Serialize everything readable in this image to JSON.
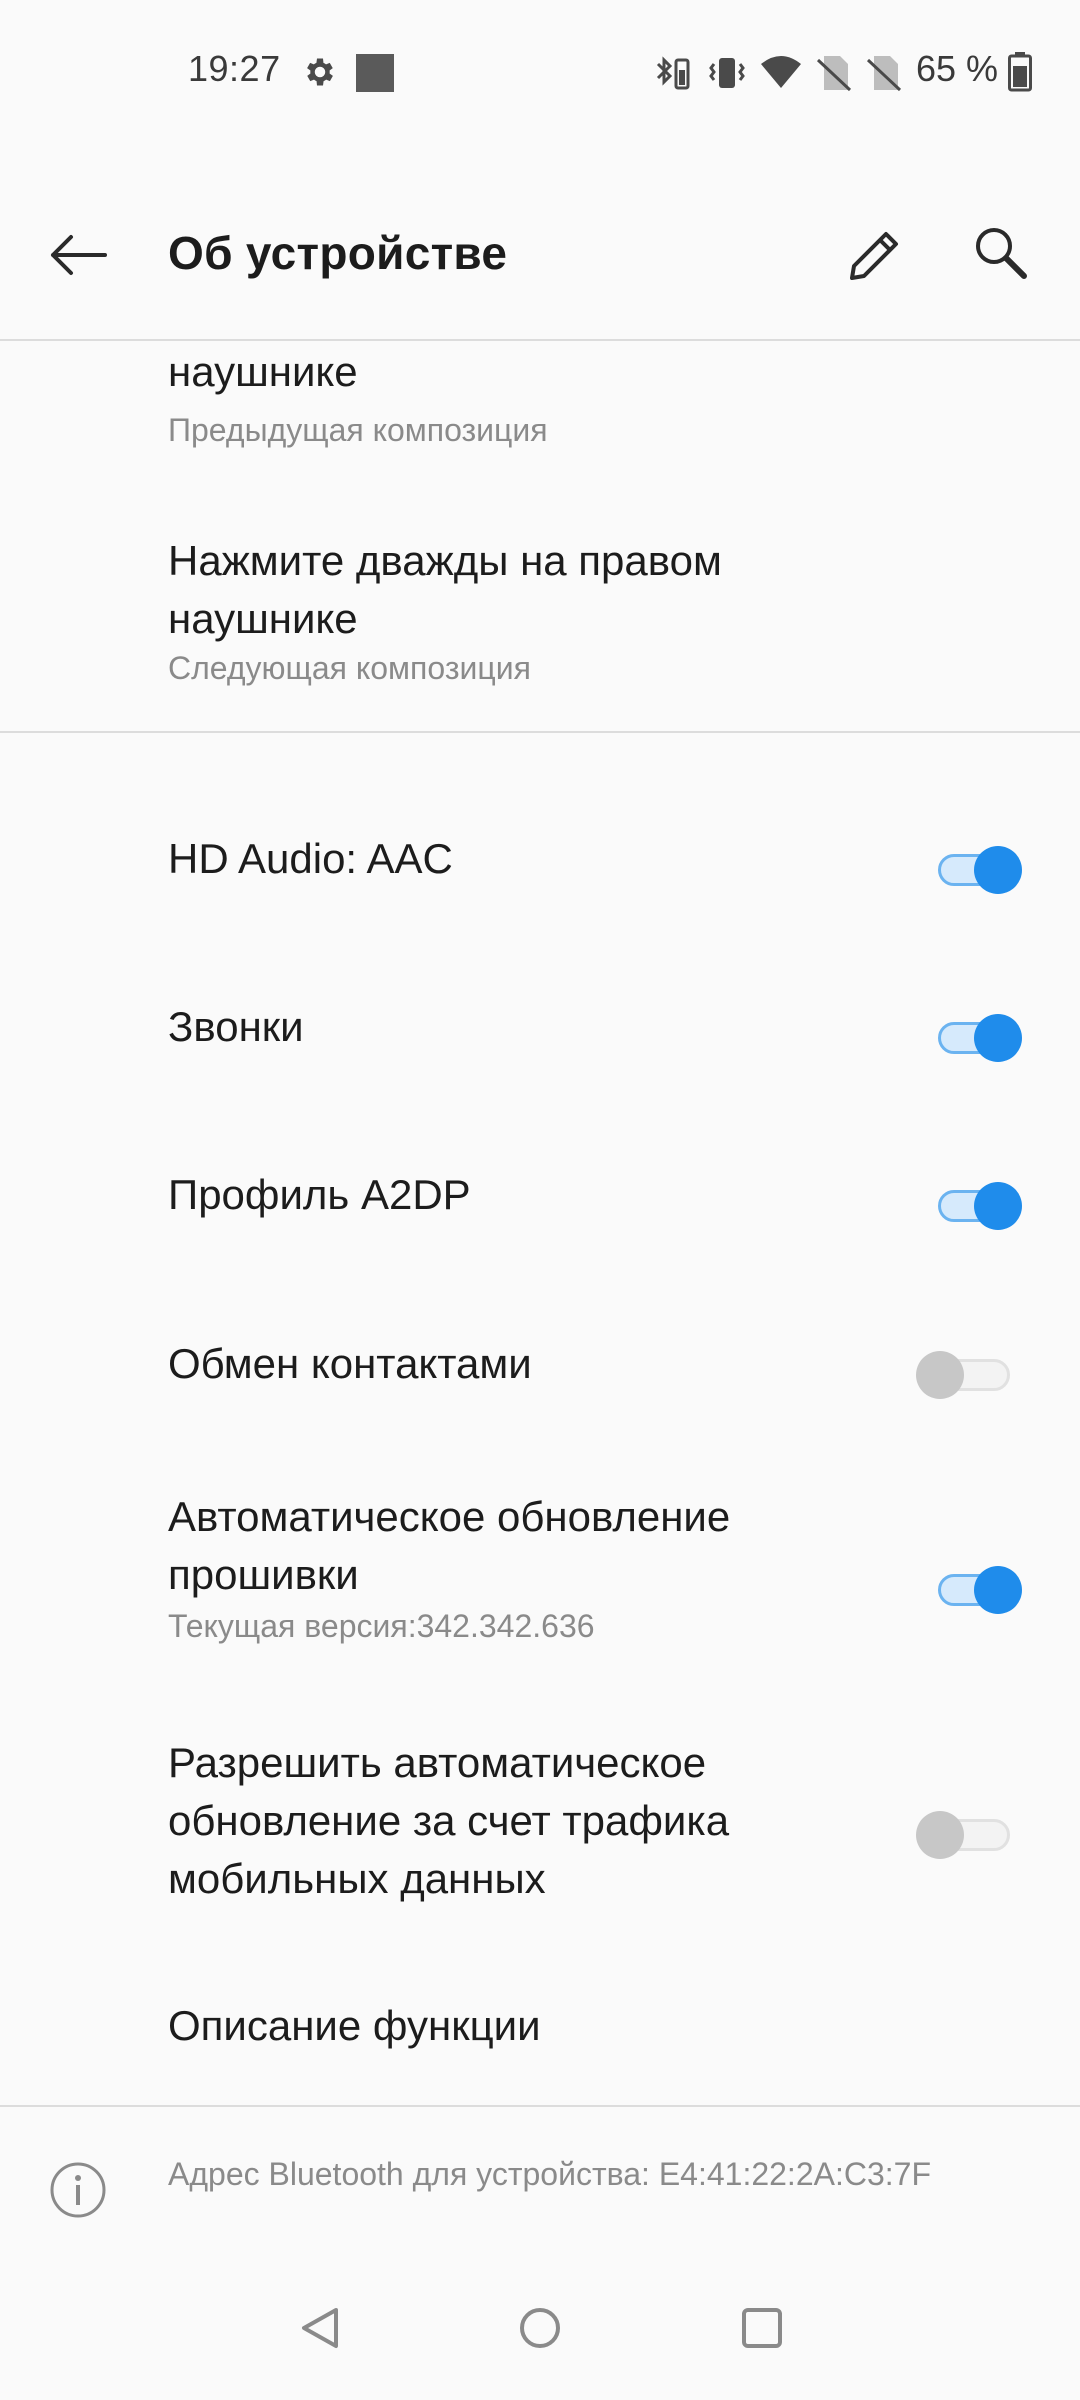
{
  "status_bar": {
    "time": "19:27",
    "battery_text": "65 %",
    "icons": [
      "gear-icon",
      "square-notification-icon",
      "bluetooth-battery-icon",
      "vibrate-icon",
      "wifi-icon",
      "no-sim-icon",
      "no-sim-icon",
      "battery-icon"
    ]
  },
  "app_bar": {
    "title": "Об устройстве",
    "icons": [
      "back-arrow-icon",
      "pencil-icon",
      "search-icon"
    ]
  },
  "list": {
    "items": [
      {
        "title": "Нажмите дважды на левом наушнике",
        "subtitle": "Предыдущая композиция"
      },
      {
        "title": "Нажмите дважды на правом наушнике",
        "subtitle": "Следующая композиция"
      },
      {
        "title": "HD Audio: AAC",
        "toggle": true
      },
      {
        "title": "Звонки",
        "toggle": true
      },
      {
        "title": "Профиль A2DP",
        "toggle": true
      },
      {
        "title": "Обмен контактами",
        "toggle": false
      },
      {
        "title": "Автоматическое обновление прошивки",
        "subtitle": "Текущая версия:342.342.636",
        "toggle": true
      },
      {
        "title": "Разрешить автоматическое обновление за счет трафика мобильных данных",
        "toggle": false
      },
      {
        "title": "Описание функции"
      }
    ]
  },
  "footer": {
    "bt_address": "Адрес Bluetooth для устройства: E4:41:22:2A:C3:7F"
  },
  "nav_bar": {
    "icons": [
      "back-triangle-icon",
      "home-circle-icon",
      "recents-square-icon"
    ]
  },
  "colors": {
    "accent": "#1f8ceb",
    "background": "#fafafa",
    "text_primary": "#1c1c1c",
    "text_secondary": "#8a8a8a"
  }
}
